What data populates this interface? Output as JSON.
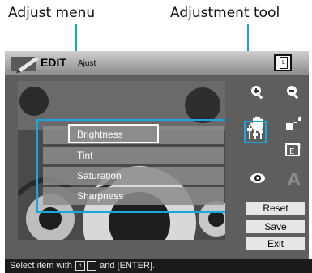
{
  "callouts": {
    "adjust_menu": "Adjust menu",
    "adjustment_tool": "Adjustment tool"
  },
  "header": {
    "mode": "EDIT",
    "submode": "Ajust",
    "print_icon_letter": "L"
  },
  "menu": {
    "items": [
      "Brightness",
      "Tint",
      "Saturation",
      "Sharpness"
    ],
    "selected_index": 0
  },
  "tools": [
    {
      "icon": "zoom-in-icon"
    },
    {
      "icon": "zoom-out-icon"
    },
    {
      "icon": "hand-icon"
    },
    {
      "icon": "resize-icon"
    },
    {
      "icon": "adjust-sliders-icon"
    },
    {
      "icon": "frame-icon"
    },
    {
      "icon": "red-eye-icon"
    },
    {
      "icon": "text-icon"
    }
  ],
  "buttons": {
    "reset": "Reset",
    "save": "Save",
    "exit": "Exit"
  },
  "status": {
    "prefix": "Select item with",
    "and": "and",
    "enter": "[ENTER]."
  },
  "colors": {
    "accent": "#19a7e0"
  }
}
